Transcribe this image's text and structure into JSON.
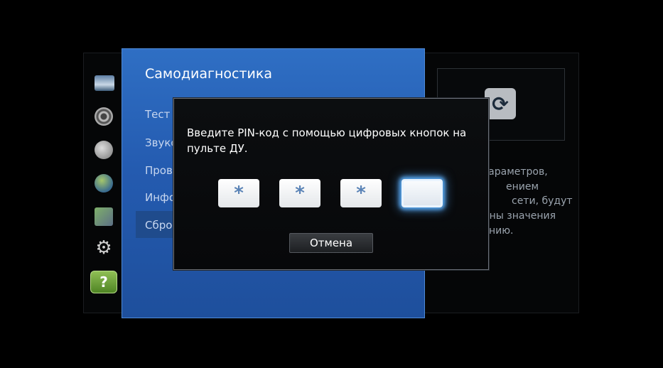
{
  "sidebar": {
    "icons": [
      "picture-icon",
      "sound-icon",
      "broadcast-icon",
      "network-icon",
      "system-icon",
      "gear-icon",
      "support-icon"
    ],
    "support_glyph": "?",
    "settings_glyph": "⚙"
  },
  "panel": {
    "title": "Самодиагностика",
    "items": [
      "Тест изображения",
      "Звуковой тест",
      "Проверка уровня сигнала",
      "Информация",
      "Сброс"
    ]
  },
  "right_panel": {
    "refresh_glyph": "⟳",
    "description_lines": [
      "параметров,",
      "ением",
      "сети, будут",
      "ены значения",
      "нию."
    ]
  },
  "dialog": {
    "message": "Введите PIN-код с помощью цифровых кнопок на пульте ДУ.",
    "pin": [
      "*",
      "*",
      "*",
      ""
    ],
    "cancel_label": "Отмена"
  },
  "colors": {
    "panel_blue": "#245bb0",
    "focus_glow": "#59a8f0",
    "pin_star": "#5a83b6"
  }
}
